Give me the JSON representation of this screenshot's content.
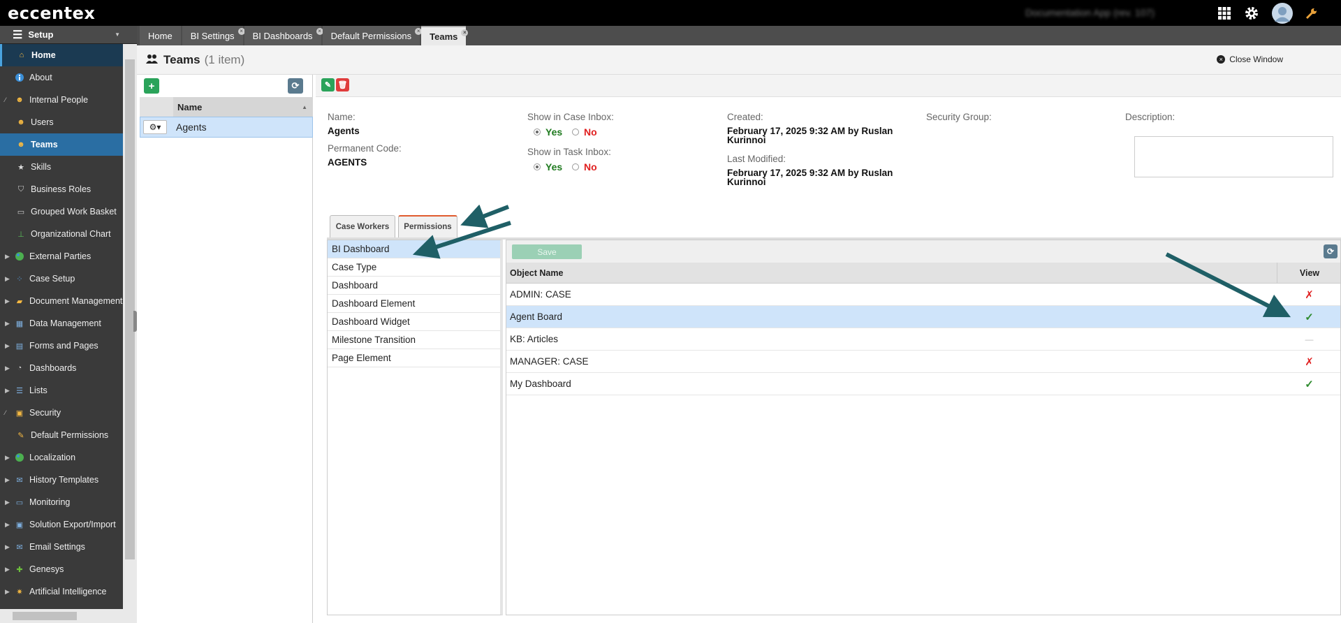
{
  "app": {
    "logo": "eccentex",
    "app_name": "Documentation App (rev. 107)"
  },
  "top_icons": [
    "apps-grid-icon",
    "settings-gear-icon",
    "user-avatar",
    "wrench-icon"
  ],
  "sidebar": {
    "title": "Setup",
    "items": [
      {
        "label": "Home",
        "icon": "home-icon"
      },
      {
        "label": "About",
        "icon": "info-icon"
      },
      {
        "label": "Internal People",
        "icon": "people-icon"
      },
      {
        "label": "Users",
        "icon": "user-icon"
      },
      {
        "label": "Teams",
        "icon": "team-icon"
      },
      {
        "label": "Skills",
        "icon": "star-icon"
      },
      {
        "label": "Business Roles",
        "icon": "shield-icon"
      },
      {
        "label": "Grouped Work Basket",
        "icon": "basket-icon"
      },
      {
        "label": "Organizational Chart",
        "icon": "org-chart-icon"
      },
      {
        "label": "External Parties",
        "icon": "globe-icon"
      },
      {
        "label": "Case Setup",
        "icon": "case-icon"
      },
      {
        "label": "Document Management",
        "icon": "folder-icon"
      },
      {
        "label": "Data Management",
        "icon": "table-icon"
      },
      {
        "label": "Forms and Pages",
        "icon": "form-icon"
      },
      {
        "label": "Dashboards",
        "icon": "dashboard-icon"
      },
      {
        "label": "Lists",
        "icon": "list-icon"
      },
      {
        "label": "Security",
        "icon": "lock-icon"
      },
      {
        "label": "Default Permissions",
        "icon": "key-icon"
      },
      {
        "label": "Localization",
        "icon": "globe-icon"
      },
      {
        "label": "History Templates",
        "icon": "history-icon"
      },
      {
        "label": "Monitoring",
        "icon": "monitor-icon"
      },
      {
        "label": "Solution Export/Import",
        "icon": "save-icon"
      },
      {
        "label": "Email Settings",
        "icon": "email-icon"
      },
      {
        "label": "Genesys",
        "icon": "puzzle-icon"
      },
      {
        "label": "Artificial Intelligence",
        "icon": "ai-icon"
      }
    ]
  },
  "tabs": [
    {
      "label": "Home"
    },
    {
      "label": "BI Settings"
    },
    {
      "label": "BI Dashboards"
    },
    {
      "label": "Default Permissions"
    },
    {
      "label": "Teams"
    }
  ],
  "page": {
    "title": "Teams",
    "count": "(1 item)",
    "close_label": "Close Window"
  },
  "list": {
    "header": "Name",
    "rows": [
      "Agents"
    ]
  },
  "details": {
    "name_label": "Name:",
    "name": "Agents",
    "code_label": "Permanent Code:",
    "code": "AGENTS",
    "case_inbox_label": "Show in Case Inbox:",
    "task_inbox_label": "Show in Task Inbox:",
    "yes": "Yes",
    "no": "No",
    "created_label": "Created:",
    "created_line1": "February 17, 2025 9:32 AM by Ruslan",
    "created_line2": "Kurinnoi",
    "modified_label": "Last Modified:",
    "modified_line1": "February 17, 2025 9:32 AM by Ruslan",
    "modified_line2": "Kurinnoi",
    "security_label": "Security Group:",
    "description_label": "Description:"
  },
  "subtabs": [
    "Case Workers",
    "Permissions"
  ],
  "object_types": [
    "BI Dashboard",
    "Case Type",
    "Dashboard",
    "Dashboard Element",
    "Dashboard Widget",
    "Milestone Transition",
    "Page Element"
  ],
  "permissions": {
    "save_label": "Save",
    "col_name": "Object Name",
    "col_view": "View",
    "rows": [
      {
        "name": "ADMIN: CASE",
        "view": "✗",
        "state": "no"
      },
      {
        "name": "Agent Board",
        "view": "✓",
        "state": "yes"
      },
      {
        "name": "KB: Articles",
        "view": "—",
        "state": "none"
      },
      {
        "name": "MANAGER: CASE",
        "view": "✗",
        "state": "no"
      },
      {
        "name": "My Dashboard",
        "view": "✓",
        "state": "yes"
      }
    ]
  },
  "colors": {
    "accent": "#2a6ea3",
    "selected_row": "#cfe4fa",
    "add_button": "#2aa35a",
    "delete_button": "#e03c3c",
    "arrow": "#1f5f66"
  }
}
